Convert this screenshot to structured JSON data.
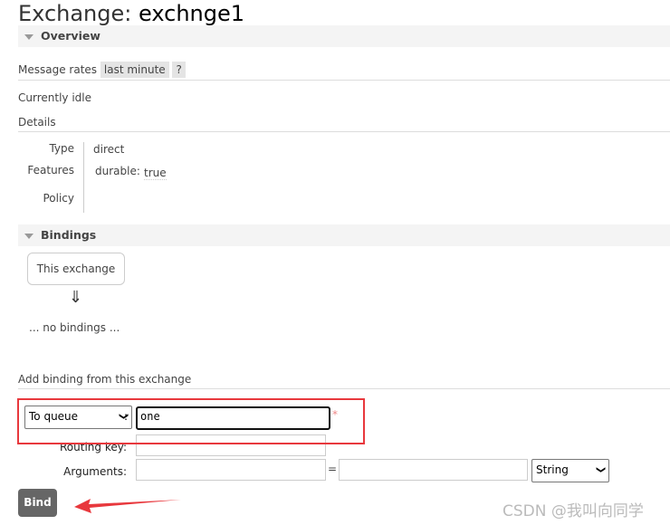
{
  "title": {
    "prefix": "Exchange:",
    "name": "exchnge1"
  },
  "overview": {
    "label": "Overview",
    "message_rates": "Message rates",
    "range": "last minute",
    "help": "?",
    "status": "Currently idle",
    "details": "Details",
    "type_label": "Type",
    "type_value": "direct",
    "features_label": "Features",
    "durable_label": "durable:",
    "durable_value": "true",
    "policy_label": "Policy"
  },
  "bindings": {
    "label": "Bindings",
    "this_exchange": "This exchange",
    "arrow": "⇓",
    "none": "... no bindings ..."
  },
  "add_binding": {
    "heading": "Add binding from this exchange",
    "destination_type": "To queue",
    "colon": ":",
    "destination_value": "one",
    "required": "*",
    "routing_key_label": "Routing key:",
    "routing_key_value": "",
    "arguments_label": "Arguments:",
    "equals": "=",
    "arg_type": "String",
    "bind_label": "Bind"
  },
  "watermark": "CSDN @我叫向同学",
  "annotation_color": "#e8383d"
}
